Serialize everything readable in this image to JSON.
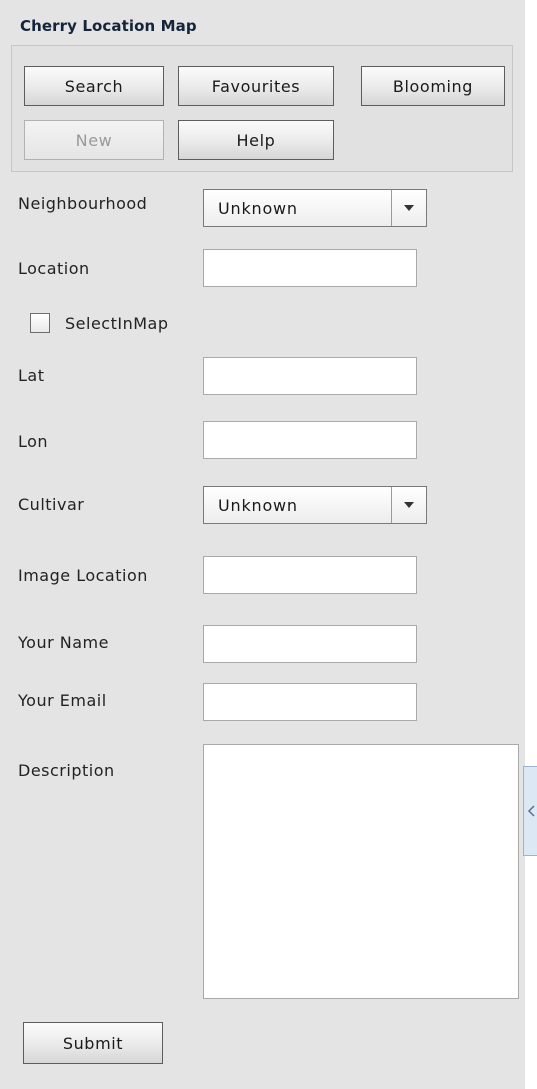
{
  "panel": {
    "title": "Cherry Location Map"
  },
  "buttons": {
    "search": "Search",
    "favourites": "Favourites",
    "blooming": "Blooming",
    "new": "New",
    "help": "Help"
  },
  "form": {
    "neighbourhood": {
      "label": "Neighbourhood",
      "value": "Unknown"
    },
    "location": {
      "label": "Location",
      "value": ""
    },
    "select_in_map": {
      "label": "SelectInMap",
      "checked": false
    },
    "lat": {
      "label": "Lat",
      "value": ""
    },
    "lon": {
      "label": "Lon",
      "value": ""
    },
    "cultivar": {
      "label": "Cultivar",
      "value": "Unknown"
    },
    "image_location": {
      "label": "Image Location",
      "value": ""
    },
    "your_name": {
      "label": "Your Name",
      "value": ""
    },
    "your_email": {
      "label": "Your Email",
      "value": ""
    },
    "description": {
      "label": "Description",
      "value": ""
    },
    "submit": "Submit"
  },
  "icons": {
    "dropdown": "chevron-down-icon",
    "collapse_handle": "chevron-left-icon"
  },
  "colors": {
    "panel_bg": "#e4e4e4",
    "title": "#13243b",
    "handle_bg": "#dde8f5"
  }
}
